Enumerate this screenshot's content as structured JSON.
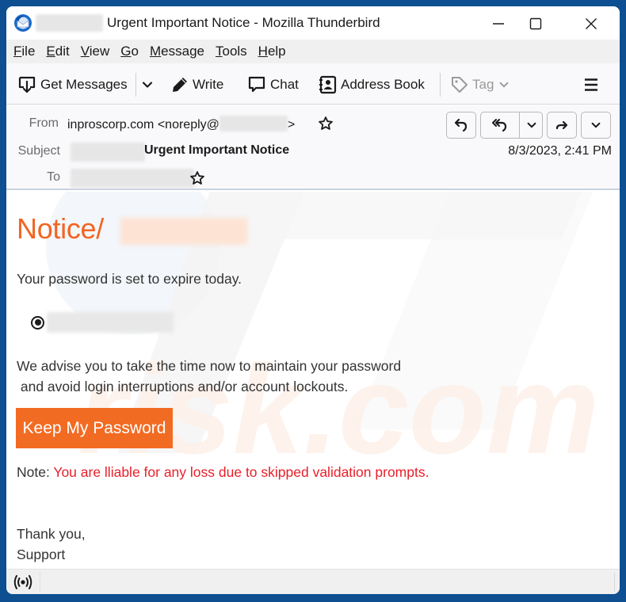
{
  "window": {
    "title": "Urgent Important Notice - Mozilla Thunderbird",
    "controls": {
      "minimize": "minimize",
      "maximize": "maximize",
      "close": "close"
    }
  },
  "menubar": {
    "items": [
      {
        "label_u": "F",
        "label_rest": "ile"
      },
      {
        "label_u": "E",
        "label_rest": "dit"
      },
      {
        "label_u": "V",
        "label_rest": "iew"
      },
      {
        "label_u": "G",
        "label_rest": "o"
      },
      {
        "label_u": "M",
        "label_rest": "essage"
      },
      {
        "label_u": "T",
        "label_rest": "ools"
      },
      {
        "label_u": "H",
        "label_rest": "elp"
      }
    ]
  },
  "toolbar": {
    "get_messages": "Get Messages",
    "write": "Write",
    "chat": "Chat",
    "address_book": "Address Book",
    "tag": "Tag"
  },
  "header": {
    "from_label": "From",
    "from_value": "inproscorp.com <noreply@",
    "from_suffix": ">",
    "subject_label": "Subject",
    "subject_value": "Urgent Important Notice",
    "to_label": "To",
    "date": "8/3/2023, 2:41 PM"
  },
  "body": {
    "notice_title": "Notice/",
    "line1": "Your password is set to expire today.",
    "advise_line1": "We advise you to take the time now to maintain your password",
    "advise_line2": " and avoid login interruptions and/or account lockouts.",
    "cta_label": "Keep My Password",
    "note_label": "Note: ",
    "note_text": "You are lliable for any loss due to skipped validation prompts.",
    "signoff1": "Thank you,",
    "signoff2": "Support"
  },
  "colors": {
    "accent_orange": "#f26522",
    "button_orange": "#f26b23",
    "warning_red": "#e8202a",
    "desktop_blue": "#0d4f91"
  }
}
